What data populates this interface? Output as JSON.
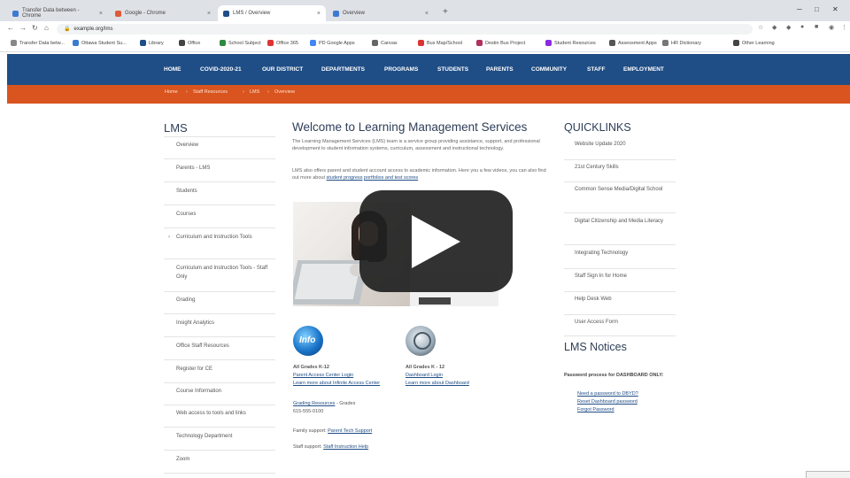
{
  "browser": {
    "tabs": [
      {
        "title": "Transfer Data between - Chrome",
        "active": false
      },
      {
        "title": "Google - Chrome",
        "active": false
      },
      {
        "title": "LMS / Overview",
        "active": true
      },
      {
        "title": "Overview",
        "active": false
      }
    ],
    "new_tab": "+",
    "url": "example.org/lms",
    "bookmarks": [
      "Transfer Data betw...",
      "Ottawa Student Su...",
      "Library",
      "Office",
      "School Subject",
      "Office 365",
      "PD Google Apps",
      "Canvas",
      "Bus Map/School",
      "Destin Bus Project",
      "Student Resources",
      "Assessment Apps",
      "HR Dictionary",
      "Other Learning"
    ]
  },
  "site": {
    "nav": [
      "HOME",
      "COVID-2020-21",
      "OUR DISTRICT",
      "DEPARTMENTS",
      "PROGRAMS",
      "STUDENTS",
      "PARENTS",
      "COMMUNITY",
      "STAFF",
      "EMPLOYMENT"
    ],
    "breadcrumb": [
      "Home",
      "Staff Resources",
      "LMS",
      "Overview"
    ]
  },
  "sidebar": {
    "heading": "LMS",
    "items": [
      "Overview",
      "Parents - LMS",
      "Students",
      "Courses",
      "Curriculum and Instruction Tools",
      "Curriculum and Instruction Tools - Staff Only",
      "Grading",
      "Insight Analytics",
      "Office Staff Resources",
      "Register for CE",
      "Course Information",
      "Web access to tools and links",
      "Technology Department",
      "Zoom"
    ]
  },
  "main": {
    "title": "Welcome to Learning Management Services",
    "para1": "The Learning Management Services (LMS) team is a service group providing assistance, support, and professional development to student information systems, curriculum, assessment and instructional technology.",
    "para2_text": "LMS also offers parent and student account access to academic information. Here you a few videos, you can also find out more about",
    "para2_link1": "student progress",
    "para2_link2": "portfolios and test scores",
    "info_block": {
      "grades": "All Grades K-12",
      "links": [
        "Parent Access Center Login",
        "Learn more about Infinite Access Center"
      ],
      "contact_label": "Grading Resources",
      "contact_tail": "- Grades",
      "phone": "615-555-0100"
    },
    "dash_block": {
      "grades": "All Grades K - 12",
      "links": [
        "Dashboard Login",
        "Learn more about Dashboard"
      ]
    },
    "family_label": "Family support:",
    "family_link": "Parent Tech Support",
    "staff_label": "Staff support:",
    "staff_link": "Staff Instruction Help"
  },
  "quicklinks": {
    "heading": "QUICKLINKS",
    "items": [
      "Website Update 2020",
      "21st Century Skills",
      "Common Sense Media/Digital School",
      "Digital Citizenship and Media Literacy",
      "Integrating Technology",
      "Staff Sign In for Home",
      "Help Desk Web",
      "User Access Form"
    ]
  },
  "notices": {
    "heading": "LMS Notices",
    "intro": "Password process for DASHBOARD ONLY:",
    "links": [
      "Need a password to DBYD?",
      "Reset Dashboard password",
      "Forgot Password"
    ]
  },
  "colors": {
    "nav_blue": "#1f4d85",
    "accent_orange": "#d9541e",
    "heading": "#2e3e58"
  },
  "icons": [
    "play-icon",
    "info-badge-icon",
    "globe-badge-icon",
    "lock-icon",
    "back-icon",
    "forward-icon",
    "reload-icon",
    "home-icon"
  ]
}
